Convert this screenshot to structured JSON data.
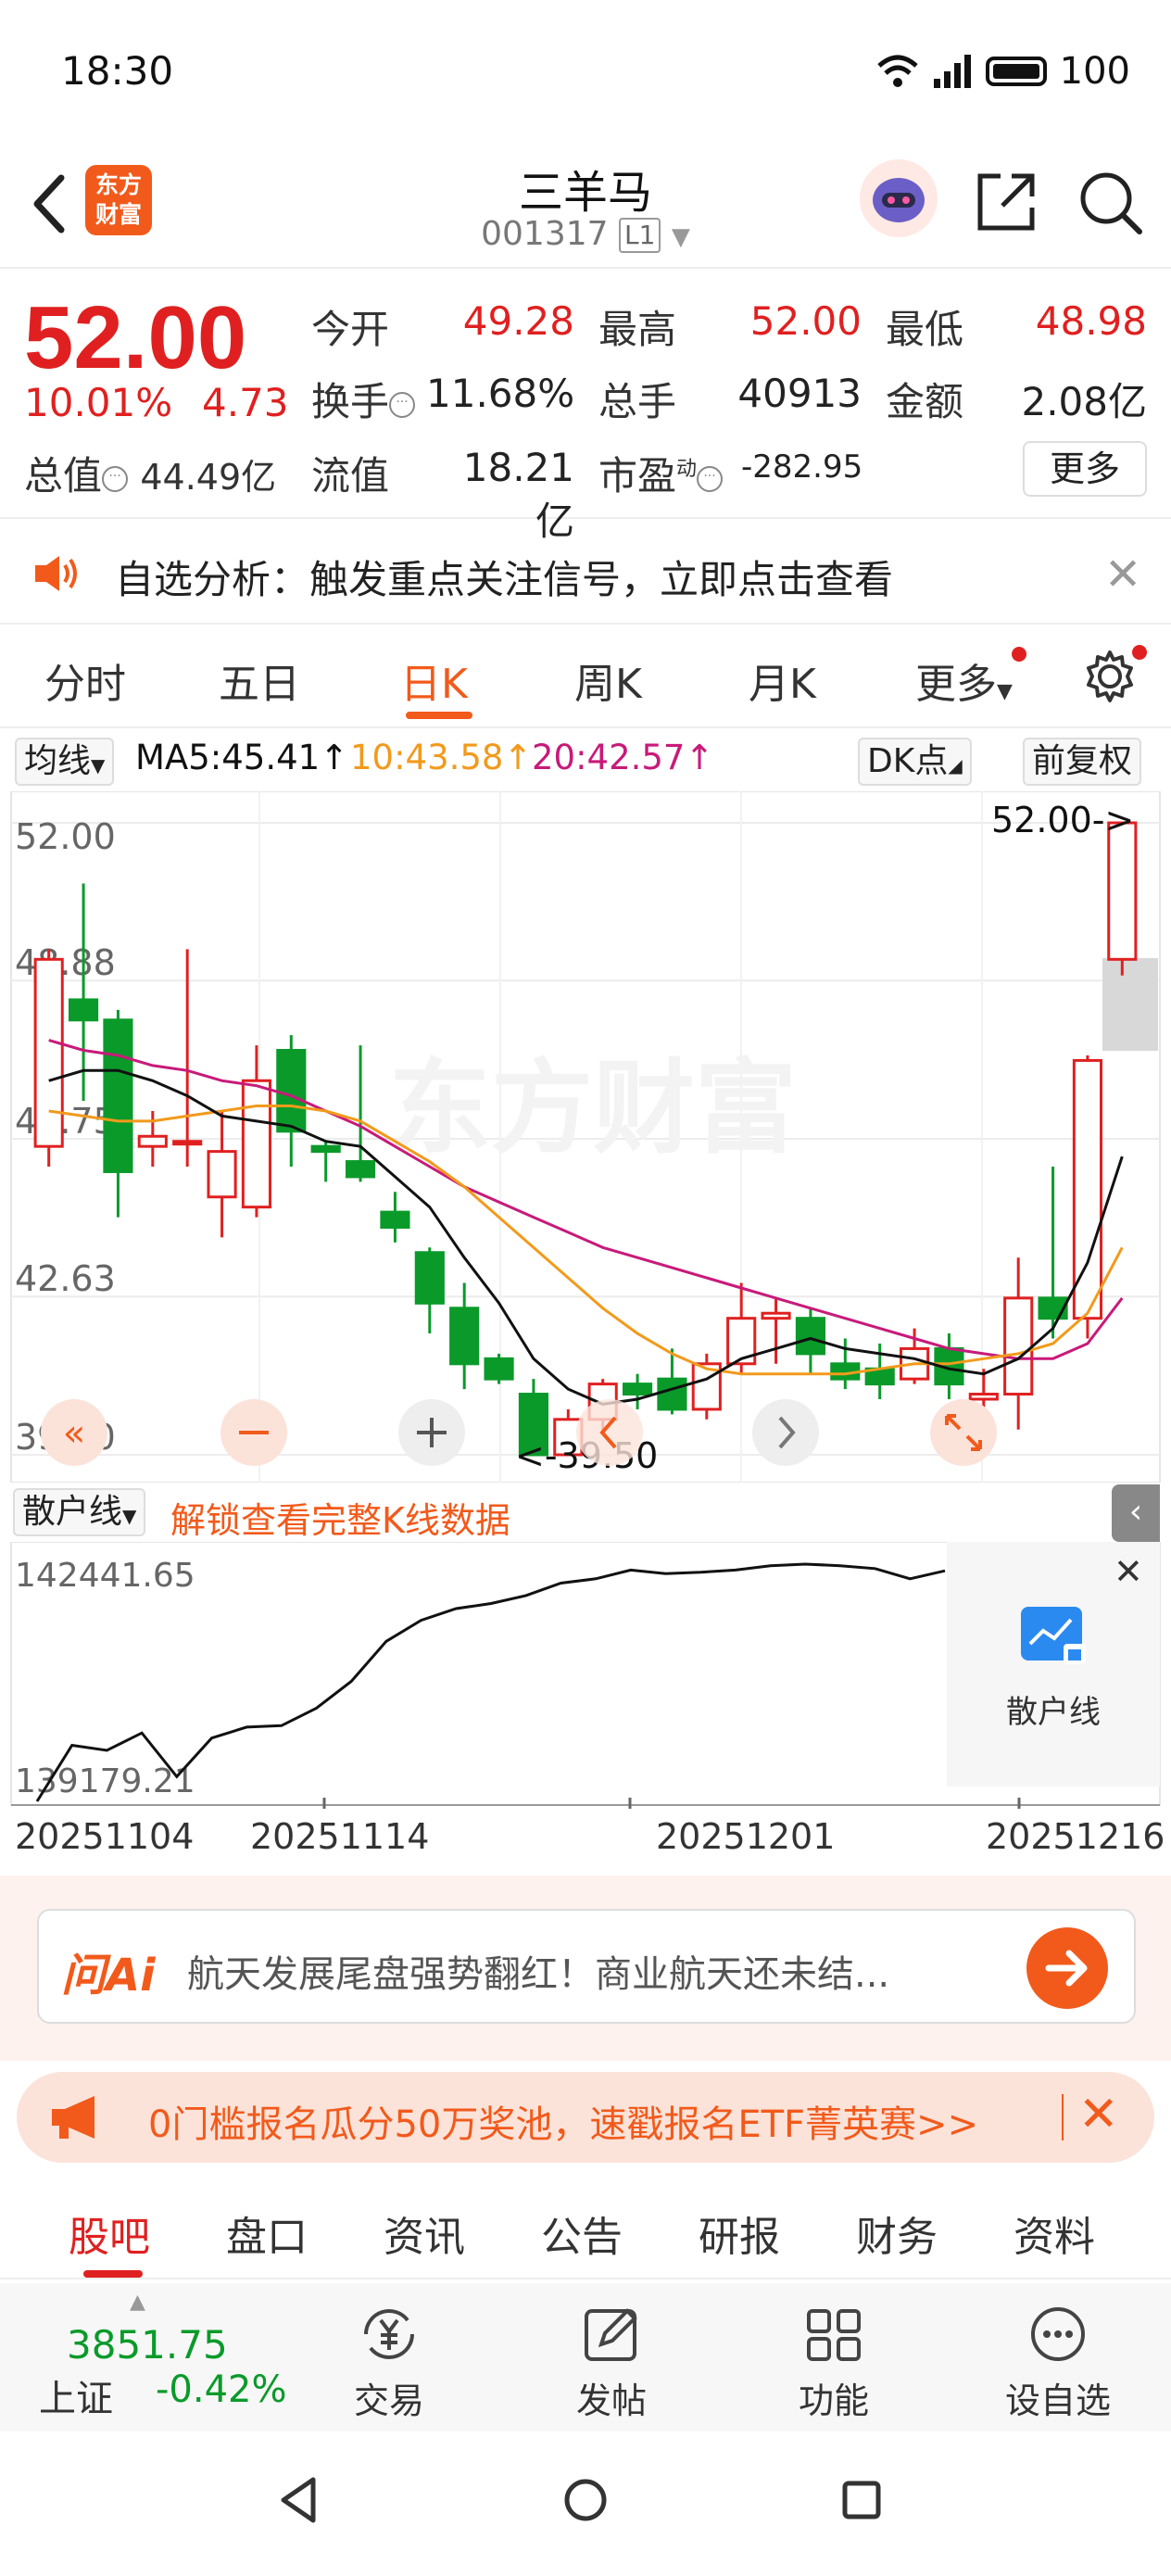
{
  "status": {
    "time": "18:30",
    "battery": "100"
  },
  "header": {
    "name": "三羊马",
    "code": "001317",
    "level_badge": "L1",
    "logo_text": "东方财富"
  },
  "quote": {
    "price": "52.00",
    "pct_change": "10.01%",
    "abs_change": "4.73",
    "open_label": "今开",
    "open": "49.28",
    "high_label": "最高",
    "high": "52.00",
    "low_label": "最低",
    "low": "48.98",
    "turnover_label": "换手",
    "turnover": "11.68%",
    "volume_label": "总手",
    "volume": "40913",
    "amount_label": "金额",
    "amount": "2.08亿",
    "total_value_label": "总值",
    "total_value": "44.49亿",
    "float_value_label": "流值",
    "float_value": "18.21亿",
    "pe_label": "市盈",
    "pe_sup": "动",
    "pe": "-282.95",
    "more": "更多"
  },
  "alert": {
    "text": "自选分析：触发重点关注信号，立即点击查看"
  },
  "period_tabs": [
    "分时",
    "五日",
    "日K",
    "周K",
    "月K",
    "更多"
  ],
  "ma_row": {
    "ma_type": "均线",
    "ma5": "MA5:45.41↑",
    "ma10": "10:43.58↑",
    "ma20": "20:42.57↑",
    "dk_point": "DK点",
    "adjust": "前复权"
  },
  "colors": {
    "up": "#e02020",
    "down": "#0a9a2a",
    "ma5": "#111111",
    "ma10": "#f29a1b",
    "ma20": "#c81a7a",
    "accent": "#f25a1b"
  },
  "chart_data": [
    {
      "type": "candlestick",
      "title": "",
      "y_ticks": [
        "52.00",
        "48.88",
        "45.75",
        "42.63",
        "39.50"
      ],
      "ylim": [
        39.5,
        52.0
      ],
      "max_label": "52.00->",
      "min_label": "<-39.50",
      "candles": [
        {
          "o": 45.6,
          "c": 49.3,
          "h": 49.5,
          "l": 45.2
        },
        {
          "o": 48.5,
          "c": 48.1,
          "h": 50.8,
          "l": 46.5
        },
        {
          "o": 48.1,
          "c": 45.1,
          "h": 48.3,
          "l": 44.2
        },
        {
          "o": 45.6,
          "c": 45.8,
          "h": 46.3,
          "l": 45.2
        },
        {
          "o": 45.7,
          "c": 45.7,
          "h": 49.5,
          "l": 45.2
        },
        {
          "o": 44.6,
          "c": 45.5,
          "h": 46.3,
          "l": 43.8
        },
        {
          "o": 44.4,
          "c": 46.9,
          "h": 47.6,
          "l": 44.2
        },
        {
          "o": 47.5,
          "c": 45.9,
          "h": 47.8,
          "l": 45.2
        },
        {
          "o": 45.6,
          "c": 45.5,
          "h": 45.7,
          "l": 44.9
        },
        {
          "o": 45.3,
          "c": 45.0,
          "h": 47.6,
          "l": 44.9
        },
        {
          "o": 44.3,
          "c": 44.0,
          "h": 44.7,
          "l": 43.7
        },
        {
          "o": 43.5,
          "c": 42.5,
          "h": 43.6,
          "l": 41.9
        },
        {
          "o": 42.4,
          "c": 41.3,
          "h": 42.9,
          "l": 40.8
        },
        {
          "o": 41.4,
          "c": 41.0,
          "h": 41.5,
          "l": 40.9
        },
        {
          "o": 40.7,
          "c": 39.5,
          "h": 41.0,
          "l": 39.5
        },
        {
          "o": 39.5,
          "c": 40.2,
          "h": 40.4,
          "l": 39.5
        },
        {
          "o": 40.2,
          "c": 40.9,
          "h": 41.0,
          "l": 39.9
        },
        {
          "o": 40.9,
          "c": 40.7,
          "h": 41.1,
          "l": 40.4
        },
        {
          "o": 41.0,
          "c": 40.4,
          "h": 41.6,
          "l": 40.3
        },
        {
          "o": 40.4,
          "c": 41.3,
          "h": 41.5,
          "l": 40.2
        },
        {
          "o": 41.3,
          "c": 42.2,
          "h": 42.9,
          "l": 41.1
        },
        {
          "o": 42.2,
          "c": 42.3,
          "h": 42.6,
          "l": 41.3
        },
        {
          "o": 42.2,
          "c": 41.5,
          "h": 42.4,
          "l": 41.1
        },
        {
          "o": 41.3,
          "c": 41.0,
          "h": 41.8,
          "l": 40.8
        },
        {
          "o": 41.2,
          "c": 40.9,
          "h": 41.7,
          "l": 40.6
        },
        {
          "o": 41.0,
          "c": 41.6,
          "h": 42.0,
          "l": 40.9
        },
        {
          "o": 41.6,
          "c": 40.9,
          "h": 41.9,
          "l": 40.6
        },
        {
          "o": 40.6,
          "c": 40.7,
          "h": 41.2,
          "l": 40.0
        },
        {
          "o": 40.7,
          "c": 42.6,
          "h": 43.4,
          "l": 40.0
        },
        {
          "o": 42.6,
          "c": 42.2,
          "h": 45.2,
          "l": 41.8
        },
        {
          "o": 42.2,
          "c": 47.3,
          "h": 47.4,
          "l": 41.8
        },
        {
          "o": 49.3,
          "c": 52.0,
          "h": 52.0,
          "l": 48.98
        }
      ],
      "ma5": [
        46.9,
        47.1,
        47.1,
        46.9,
        46.6,
        46.2,
        46.1,
        46.0,
        45.7,
        45.6,
        45.0,
        44.4,
        43.4,
        42.5,
        41.4,
        40.8,
        40.5,
        40.6,
        40.8,
        41.0,
        41.4,
        41.6,
        41.8,
        41.6,
        41.5,
        41.4,
        41.2,
        41.1,
        41.4,
        42.0,
        43.3,
        45.4
      ],
      "ma10": [
        46.3,
        46.2,
        46.1,
        46.1,
        46.2,
        46.3,
        46.4,
        46.4,
        46.3,
        46.1,
        45.7,
        45.3,
        44.8,
        44.2,
        43.6,
        43.0,
        42.4,
        41.9,
        41.5,
        41.2,
        41.1,
        41.1,
        41.1,
        41.1,
        41.2,
        41.3,
        41.3,
        41.4,
        41.5,
        41.7,
        42.3,
        43.6
      ],
      "ma20": [
        47.7,
        47.5,
        47.4,
        47.2,
        47.1,
        46.9,
        46.8,
        46.6,
        46.3,
        46.0,
        45.6,
        45.2,
        44.8,
        44.5,
        44.2,
        43.9,
        43.6,
        43.4,
        43.2,
        43.0,
        42.8,
        42.6,
        42.4,
        42.2,
        42.0,
        41.8,
        41.6,
        41.5,
        41.4,
        41.4,
        41.7,
        42.6
      ]
    },
    {
      "type": "line",
      "title": "",
      "series": [
        {
          "name": "散户线",
          "values": [
            139179.21,
            139950,
            139880,
            140120,
            139520,
            140050,
            140200,
            140220,
            140460,
            140830,
            141380,
            141670,
            141830,
            141900,
            142010,
            142180,
            142240,
            142360,
            142310,
            142330,
            142360,
            142420,
            142441.65,
            142420,
            142380,
            142240,
            142350
          ]
        }
      ],
      "y_ticks": [
        "142441.65",
        "139179.21"
      ],
      "ylim": [
        139179.21,
        142441.65
      ],
      "x_ticks": [
        "20251104",
        "20251114",
        "20251201",
        "20251216"
      ]
    }
  ],
  "sub_chart": {
    "label": "散户线",
    "unlock_text": "解锁查看完整K线数据",
    "lock_label": "散户线"
  },
  "dates": [
    "20251104",
    "20251114",
    "20251201",
    "20251216"
  ],
  "ai": {
    "logo": "问Ai",
    "text": "航天发展尾盘强势翻红！商业航天还未结..."
  },
  "promo": {
    "text": "0门槛报名瓜分50万奖池，速戳报名ETF菁英赛>>"
  },
  "bottom_tabs": [
    "股吧",
    "盘口",
    "资讯",
    "公告",
    "研报",
    "财务",
    "资料"
  ],
  "toolbar": {
    "index_value": "3851.75",
    "index_name": "上证",
    "index_change": "-0.42%",
    "trade": "交易",
    "post": "发帖",
    "functions": "功能",
    "add_watch": "设自选"
  }
}
